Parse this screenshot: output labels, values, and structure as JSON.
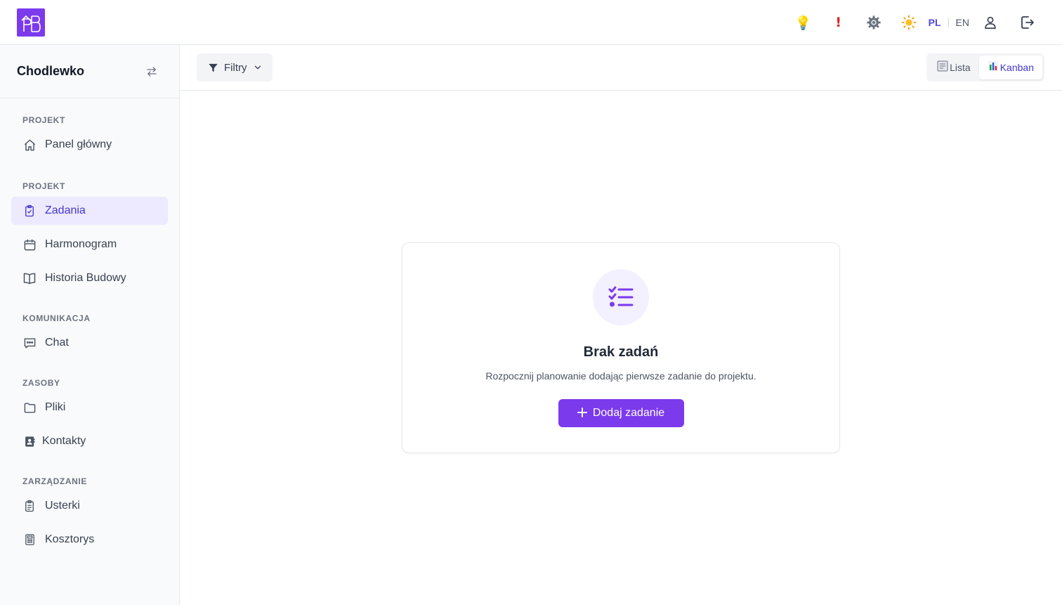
{
  "header": {
    "logo_text": "PB",
    "icons": [
      {
        "name": "lightbulb-icon",
        "glyph": "💡",
        "color": "#facc15"
      },
      {
        "name": "exclamation-icon",
        "glyph": "❗",
        "color": "#dc2626"
      },
      {
        "name": "gear-icon",
        "glyph": "⚙",
        "color": "#4b5563"
      },
      {
        "name": "sun-icon",
        "glyph": "☀",
        "color": "#f59e0b"
      }
    ],
    "lang_pl": "PL",
    "lang_en": "EN",
    "brand_color": "#7c3aed"
  },
  "sidebar": {
    "project_name": "Chodlewko",
    "sections": [
      {
        "label": "PROJEKT",
        "items": [
          {
            "label": "Panel główny",
            "icon": "home-icon",
            "active": false
          }
        ]
      },
      {
        "label": "PROJEKT",
        "items": [
          {
            "label": "Zadania",
            "icon": "clipboard-check-icon",
            "active": true
          },
          {
            "label": "Harmonogram",
            "icon": "calendar-icon",
            "active": false
          },
          {
            "label": "Historia Budowy",
            "icon": "book-icon",
            "active": false
          }
        ]
      },
      {
        "label": "KOMUNIKACJA",
        "items": [
          {
            "label": "Chat",
            "icon": "chat-icon",
            "active": false
          }
        ]
      },
      {
        "label": "ZASOBY",
        "items": [
          {
            "label": "Pliki",
            "icon": "folder-icon",
            "active": false
          },
          {
            "label": "Kontakty",
            "icon": "contacts-icon",
            "active": false
          }
        ]
      },
      {
        "label": "ZARZĄDZANIE",
        "items": [
          {
            "label": "Usterki",
            "icon": "clipboard-list-icon",
            "active": false
          },
          {
            "label": "Kosztorys",
            "icon": "calculator-icon",
            "active": false
          }
        ]
      }
    ]
  },
  "toolbar": {
    "filter_label": "Filtry",
    "view_list_label": "Lista",
    "view_kanban_label": "Kanban",
    "active_view": "Kanban"
  },
  "empty_state": {
    "title": "Brak zadań",
    "description": "Rozpocznij planowanie dodając pierwsze zadanie do projektu.",
    "button_label": "Dodaj zadanie"
  }
}
